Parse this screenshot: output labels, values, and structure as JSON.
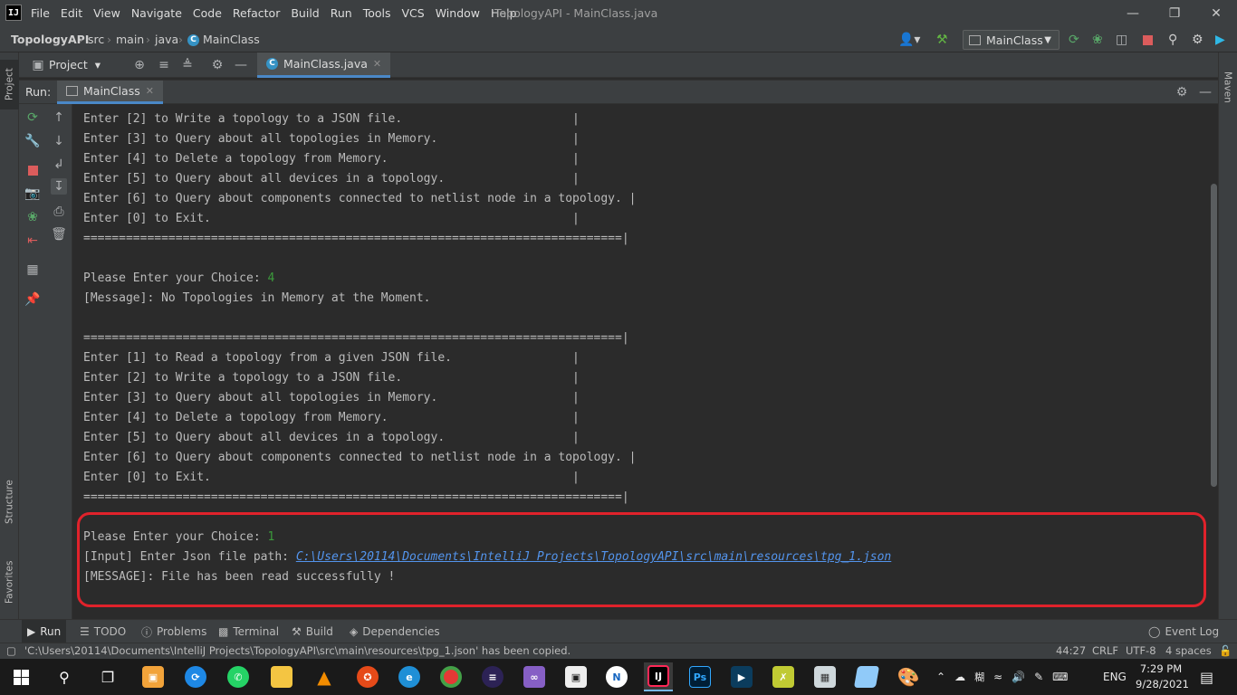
{
  "menubar": {
    "items": [
      "File",
      "Edit",
      "View",
      "Navigate",
      "Code",
      "Refactor",
      "Build",
      "Run",
      "Tools",
      "VCS",
      "Window",
      "Help"
    ],
    "window_title": "TopologyAPI - MainClass.java"
  },
  "breadcrumbs": [
    "TopologyAPI",
    "src",
    "main",
    "java",
    "MainClass"
  ],
  "run_config": "MainClass",
  "project_panel": {
    "label": "Project"
  },
  "editor_tab": {
    "label": "MainClass.java"
  },
  "run_panel": {
    "label": "Run:",
    "tab": "MainClass"
  },
  "left_tabs": {
    "project": "Project",
    "structure": "Structure",
    "favorites": "Favorites"
  },
  "right_tabs": {
    "maven": "Maven"
  },
  "console": {
    "lines": [
      "Enter [2] to Write a topology to a JSON file.                        |",
      "Enter [3] to Query about all topologies in Memory.                   |",
      "Enter [4] to Delete a topology from Memory.                          |",
      "Enter [5] to Query about all devices in a topology.                  |",
      "Enter [6] to Query about components connected to netlist node in a topology. |",
      "Enter [0] to Exit.                                                   |",
      "============================================================================|",
      "",
      "Please Enter your Choice: ",
      "[Message]: No Topologies in Memory at the Moment.",
      "",
      "============================================================================|",
      "Enter [1] to Read a topology from a given JSON file.                 |",
      "Enter [2] to Write a topology to a JSON file.                        |",
      "Enter [3] to Query about all topologies in Memory.                   |",
      "Enter [4] to Delete a topology from Memory.                          |",
      "Enter [5] to Query about all devices in a topology.                  |",
      "Enter [6] to Query about components connected to netlist node in a topology. |",
      "Enter [0] to Exit.                                                   |",
      "============================================================================|",
      "",
      "Please Enter your Choice: ",
      "[Input] Enter Json file path: ",
      "[MESSAGE]: File has been read successfully !"
    ],
    "choice_1": "4",
    "choice_2": "1",
    "file_path": "C:\\Users\\20114\\Documents\\IntelliJ Projects\\TopologyAPI\\src\\main\\resources\\tpg_1.json"
  },
  "bottom_tabs": [
    "Run",
    "TODO",
    "Problems",
    "Terminal",
    "Build",
    "Dependencies"
  ],
  "event_log": "Event Log",
  "status": {
    "message": "'C:\\Users\\20114\\Documents\\IntelliJ Projects\\TopologyAPI\\src\\main\\resources\\tpg_1.json' has been copied.",
    "position": "44:27",
    "line_sep": "CRLF",
    "encoding": "UTF-8",
    "indent": "4 spaces"
  },
  "taskbar": {
    "lang": "ENG",
    "time": "7:29 PM",
    "date": "9/28/2021"
  },
  "colors": {
    "accent": "#4a88c7",
    "highlight_box": "#e0222b",
    "console_green": "#3c9b3c",
    "link": "#5394ec"
  }
}
